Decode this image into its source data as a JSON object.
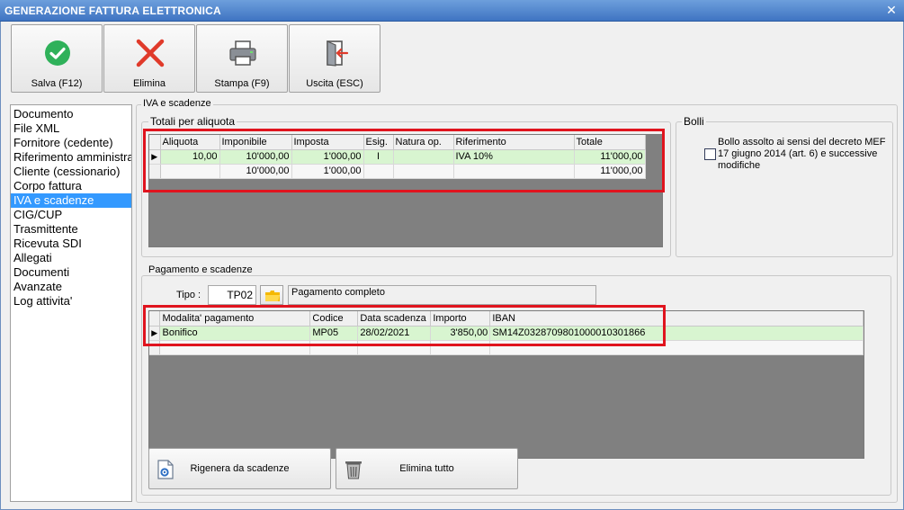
{
  "window": {
    "title": "GENERAZIONE FATTURA ELETTRONICA",
    "close_glyph": "✕"
  },
  "toolbar": {
    "save_label": "Salva (F12)",
    "delete_label": "Elimina",
    "print_label": "Stampa (F9)",
    "exit_label": "Uscita (ESC)"
  },
  "sidebar": {
    "items": [
      "Documento",
      "File XML",
      "Fornitore (cedente)",
      "Riferimento amministrativo",
      "Cliente (cessionario)",
      "Corpo fattura",
      "IVA e scadenze",
      "CIG/CUP",
      "Trasmittente",
      "Ricevuta SDI",
      "Allegati",
      "Documenti",
      "Avanzate",
      "Log attivita'"
    ],
    "selected": "IVA e scadenze"
  },
  "iva_section": {
    "title": "IVA e scadenze",
    "totals_group": "Totali per aliquota",
    "columns": [
      "Aliquota",
      "Imponibile",
      "Imposta",
      "Esig.",
      "Natura op.",
      "Riferimento",
      "Totale"
    ],
    "rows": [
      [
        "10,00",
        "10'000,00",
        "1'000,00",
        "I",
        "",
        "IVA 10%",
        "11'000,00"
      ],
      [
        "",
        "10'000,00",
        "1'000,00",
        "",
        "",
        "",
        "11'000,00"
      ]
    ]
  },
  "bolli": {
    "title": "Bolli",
    "checkbox_label": "Bollo assolto ai sensi del decreto MEF 17 giugno 2014 (art. 6) e successive modifiche",
    "checked": false
  },
  "payment": {
    "title": "Pagamento e scadenze",
    "tipo_label": "Tipo :",
    "tipo_value": "TP02",
    "tipo_description": "Pagamento completo",
    "columns": [
      "Modalita' pagamento",
      "Codice",
      "Data scadenza",
      "Importo",
      "IBAN"
    ],
    "rows": [
      [
        "Bonifico",
        "MP05",
        "28/02/2021",
        "3'850,00",
        "SM14Z0328709801000010301866"
      ]
    ],
    "regen_label": "Rigenera da scadenze",
    "delete_all_label": "Elimina tutto"
  },
  "colors": {
    "accent": "#3399ff",
    "highlight_row": "#d8f5d0",
    "annotation": "#e0141e"
  }
}
